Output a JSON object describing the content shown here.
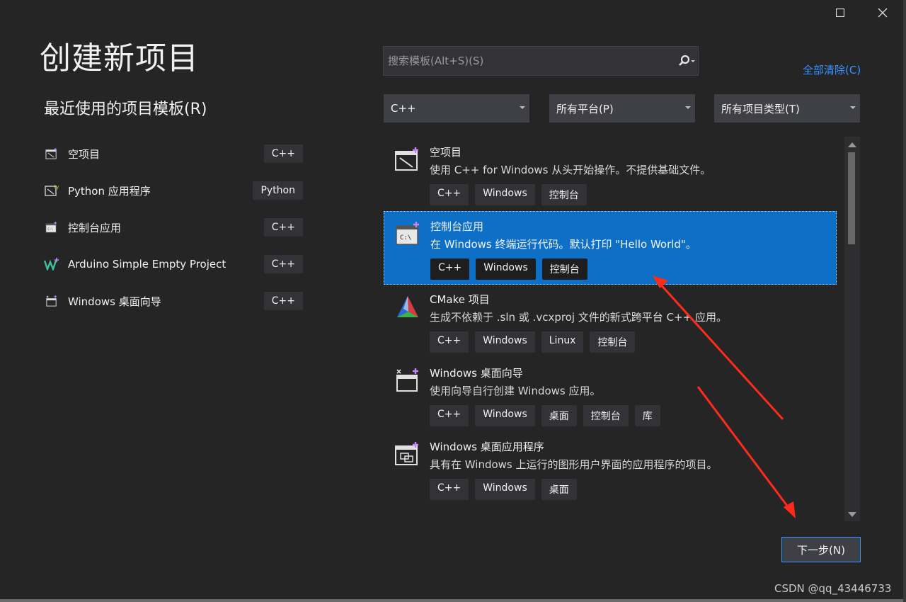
{
  "window": {
    "maximize_icon": "maximize-icon",
    "close_icon": "close-icon"
  },
  "header": {
    "title": "创建新项目"
  },
  "recent": {
    "heading": "最近使用的项目模板(R)",
    "items": [
      {
        "label": "空项目",
        "tag": "C++",
        "icon": "empty-project-icon"
      },
      {
        "label": "Python 应用程序",
        "tag": "Python",
        "icon": "python-app-icon"
      },
      {
        "label": "控制台应用",
        "tag": "C++",
        "icon": "console-app-icon"
      },
      {
        "label": "Arduino Simple Empty Project",
        "tag": "C++",
        "icon": "arduino-icon"
      },
      {
        "label": "Windows 桌面向导",
        "tag": "C++",
        "icon": "desktop-wizard-icon"
      }
    ]
  },
  "search": {
    "placeholder": "搜索模板(Alt+S)(S)"
  },
  "clear_all": "全部清除(C)",
  "filters": {
    "language": "C++",
    "platform": "所有平台(P)",
    "project_type": "所有项目类型(T)"
  },
  "templates": [
    {
      "name": "空项目",
      "desc": "使用 C++ for Windows 从头开始操作。不提供基础文件。",
      "tags": [
        "C++",
        "Windows",
        "控制台"
      ],
      "icon": "empty-project-icon",
      "selected": false
    },
    {
      "name": "控制台应用",
      "desc": "在 Windows 终端运行代码。默认打印 \"Hello World\"。",
      "tags": [
        "C++",
        "Windows",
        "控制台"
      ],
      "icon": "console-app-icon",
      "selected": true
    },
    {
      "name": "CMake 项目",
      "desc": "生成不依赖于 .sln 或 .vcxproj 文件的新式跨平台 C++ 应用。",
      "tags": [
        "C++",
        "Windows",
        "Linux",
        "控制台"
      ],
      "icon": "cmake-icon",
      "selected": false
    },
    {
      "name": "Windows 桌面向导",
      "desc": "使用向导自行创建 Windows 应用。",
      "tags": [
        "C++",
        "Windows",
        "桌面",
        "控制台",
        "库"
      ],
      "icon": "desktop-wizard-icon",
      "selected": false
    },
    {
      "name": "Windows 桌面应用程序",
      "desc": "具有在 Windows 上运行的图形用户界面的应用程序的项目。",
      "tags": [
        "C++",
        "Windows",
        "桌面"
      ],
      "icon": "desktop-app-icon",
      "selected": false
    }
  ],
  "next_button": "下一步(N)",
  "watermark": "CSDN @qq_43446733",
  "colors": {
    "background": "#252526",
    "selection": "#0e6fc6",
    "link": "#3794ff",
    "arrow": "#ff2a1a"
  }
}
